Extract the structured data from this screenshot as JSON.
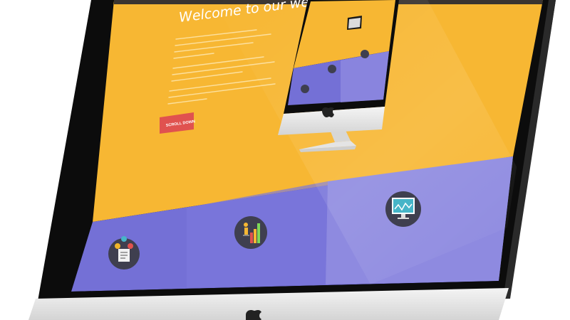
{
  "page": {
    "hero_title": "Welcome to our website",
    "scroll_button_label": "SCROLL DOWN"
  },
  "colors": {
    "yellow": "#f7b733",
    "purple": "#7470d6",
    "purple_light": "#8e8ae0",
    "bezel": "#0c0c0c",
    "body_silver": "#e6e6e6",
    "button_red": "#e0524f",
    "icon_circle": "#3f3f4f"
  },
  "features": [
    {
      "icon": "document-person-icon"
    },
    {
      "icon": "bar-chart-growth-icon"
    },
    {
      "icon": "monitor-analytics-icon"
    }
  ]
}
